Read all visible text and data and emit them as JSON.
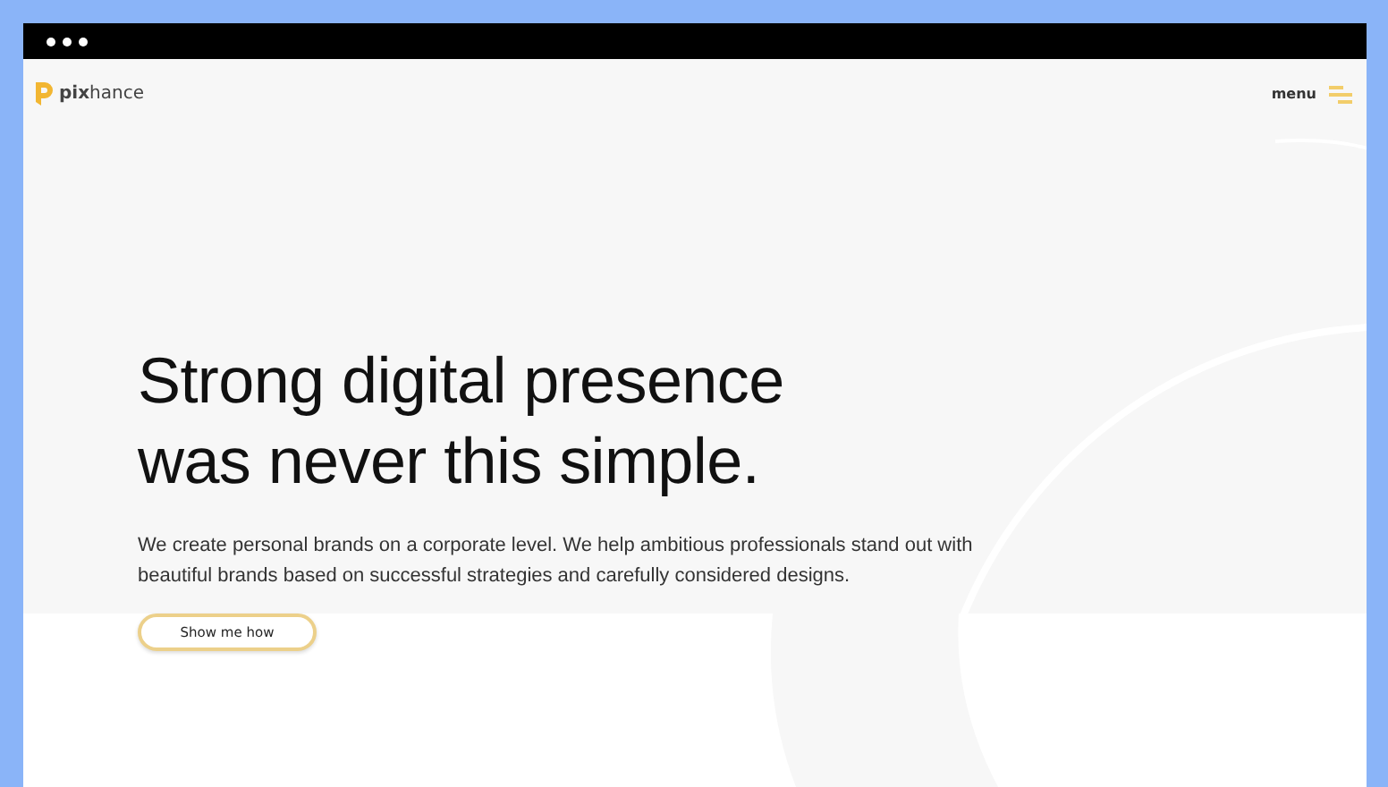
{
  "logo": {
    "text": "**pix**hance"
  },
  "menu": {
    "label": "menu"
  },
  "hero": {
    "title": "Strong digital presence was never this simple.",
    "text": "We create personal brands on a corporate level. We help ambitious professionals stand out with beautiful brands based on successful strategies and carefully considered designs.",
    "button": "Show me how"
  }
}
